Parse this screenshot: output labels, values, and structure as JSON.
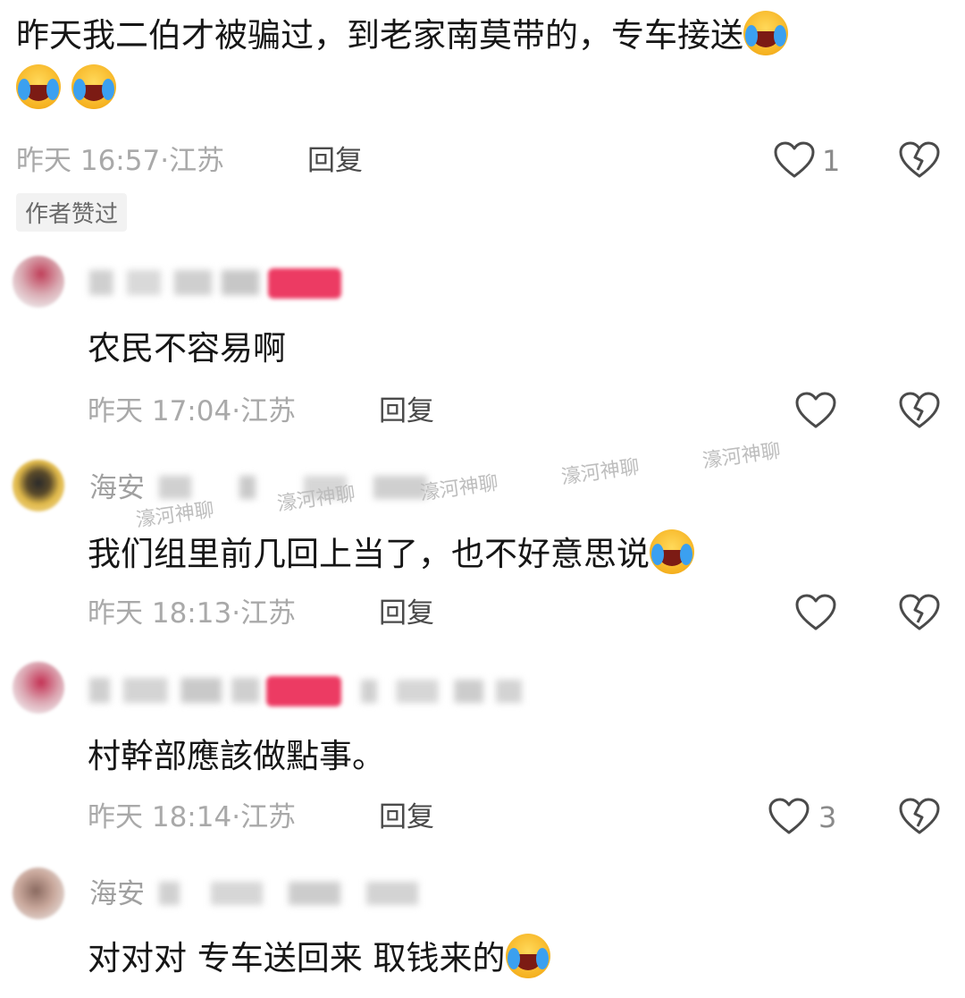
{
  "comments": [
    {
      "text": "昨天我二伯才被骗过，到老家南莫带的，专车接送",
      "time": "昨天 16:57",
      "location": "江苏",
      "reply": "回复",
      "likes": "1",
      "badge": "作者赞过"
    },
    {
      "username": "",
      "text": "农民不容易啊",
      "time": "昨天 17:04",
      "location": "江苏",
      "reply": "回复",
      "likes": ""
    },
    {
      "username": "海安",
      "text": "我们组里前几回上当了，也不好意思说",
      "time": "昨天 18:13",
      "location": "江苏",
      "reply": "回复",
      "likes": ""
    },
    {
      "username": "",
      "text": "村幹部應該做點事。",
      "time": "昨天 18:14",
      "location": "江苏",
      "reply": "回复",
      "likes": "3"
    },
    {
      "username": "海安",
      "text": "对对对 专车送回来 取钱来的"
    }
  ],
  "separator": "·",
  "watermark": "濠河神聊",
  "icons": {
    "like": "heart-outline-icon",
    "dislike": "broken-heart-icon",
    "emoji": "laughing-crying-emoji"
  },
  "colors": {
    "meta_text": "#a9a9a9",
    "reply_text": "#4a4a4a",
    "badge_pink": "#ec3b63"
  }
}
